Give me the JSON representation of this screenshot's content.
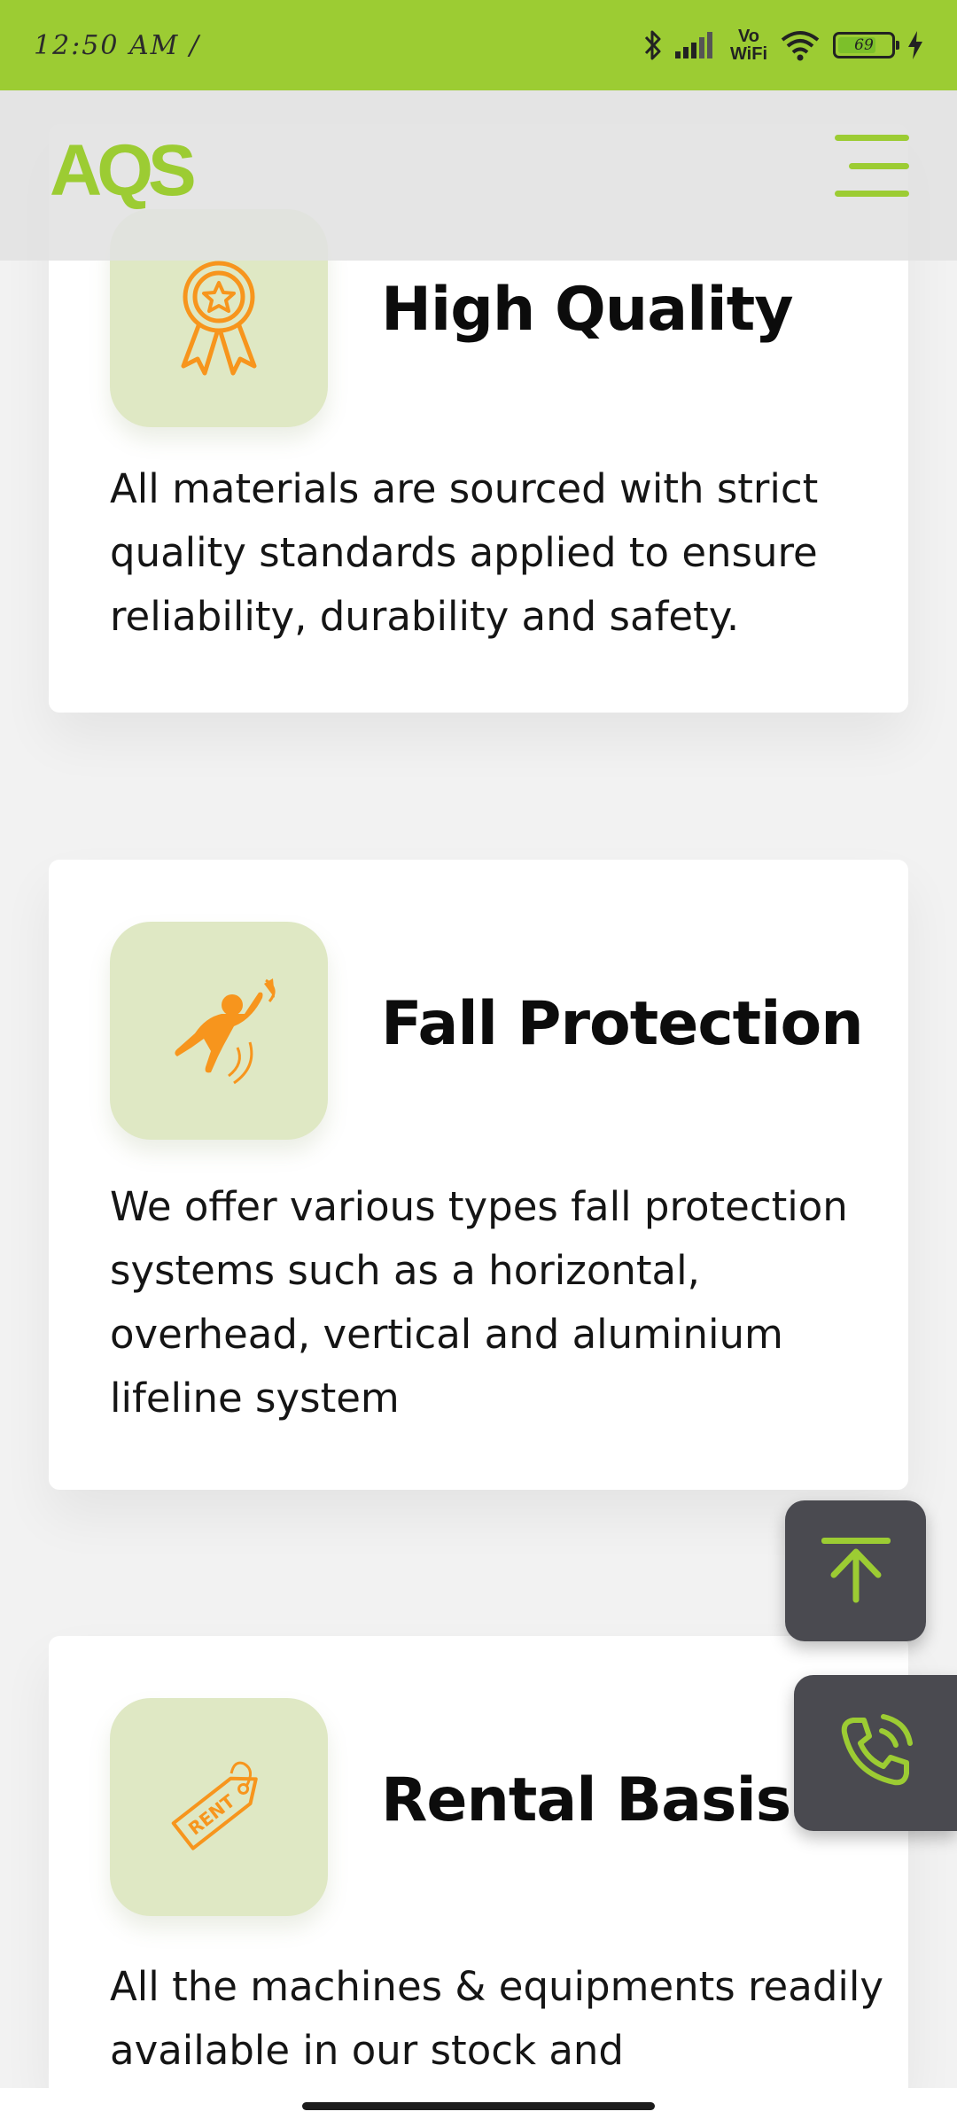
{
  "status_bar": {
    "time": "12:50 AM /",
    "network_label_top": "Vo",
    "network_label_bottom": "WiFi",
    "battery": "69"
  },
  "header": {
    "logo": "AQS"
  },
  "cards": [
    {
      "title": "High Quality",
      "icon": "award-ribbon-icon",
      "text": "All materials are sourced with strict quality standards applied to ensure reliability, durability and safety."
    },
    {
      "title": "Fall Protection",
      "icon": "falling-person-icon",
      "text": "We offer various types fall protection systems such as a horizontal, overhead, vertical and aluminium lifeline system"
    },
    {
      "title": "Rental Basis",
      "icon": "rent-tag-icon",
      "tag_text": "RENT",
      "text": "All the machines & equipments readily available in our stock and"
    }
  ],
  "colors": {
    "brand_green": "#9ccc33",
    "icon_orange": "#f7951d",
    "icon_bg": "#dfe8c4",
    "fab_bg": "#4a4a50"
  }
}
